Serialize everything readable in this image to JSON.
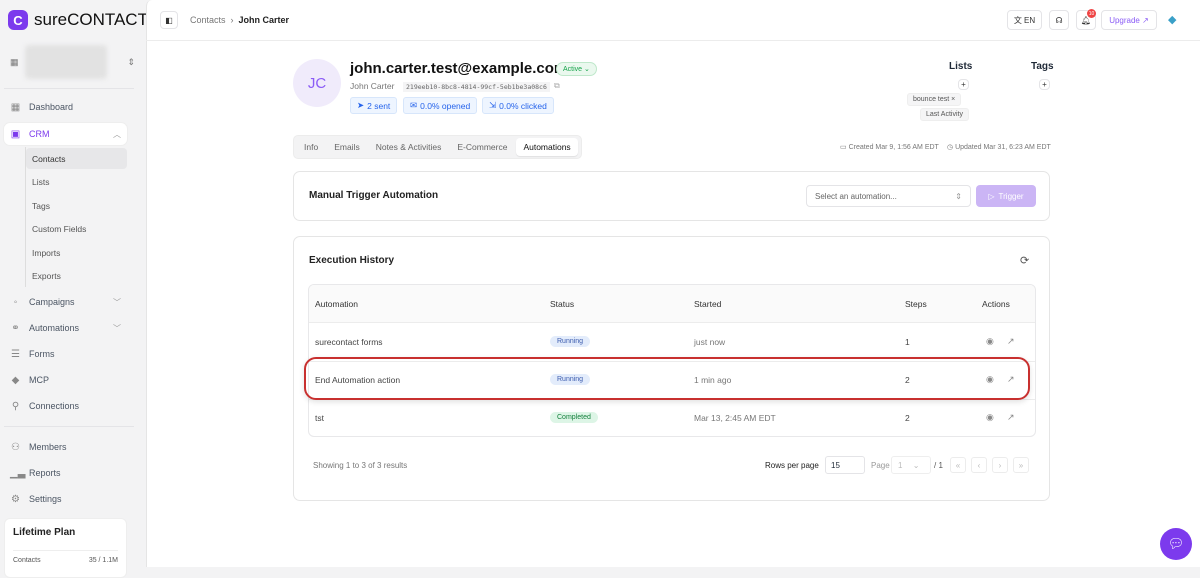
{
  "brand": {
    "logo_letter": "C",
    "name": "sureCONTACT"
  },
  "sidebar": {
    "items": [
      {
        "label": "Dashboard",
        "icon": "grid"
      },
      {
        "label": "CRM",
        "icon": "contact-card"
      },
      {
        "label": "Campaigns",
        "icon": "campaign"
      },
      {
        "label": "Automations",
        "icon": "flow"
      },
      {
        "label": "Forms",
        "icon": "form"
      },
      {
        "label": "MCP",
        "icon": "mcp"
      },
      {
        "label": "Connections",
        "icon": "plug"
      },
      {
        "label": "Members",
        "icon": "users"
      },
      {
        "label": "Reports",
        "icon": "chart"
      },
      {
        "label": "Settings",
        "icon": "gear"
      }
    ],
    "crm_sub": [
      "Contacts",
      "Lists",
      "Tags",
      "Custom Fields",
      "Imports",
      "Exports"
    ],
    "plan": {
      "title": "Lifetime Plan",
      "label": "Contacts",
      "value": "35 / 1.1M"
    }
  },
  "topbar": {
    "breadcrumb_parent": "Contacts",
    "breadcrumb_current": "John Carter",
    "lang": "EN",
    "notif_count": "10",
    "upgrade": "Upgrade ↗"
  },
  "contact": {
    "initials": "JC",
    "email": "john.carter.test@example.com",
    "status": "Active",
    "name": "John Carter",
    "id": "219eeb10-8bc8-4814-99cf-5eb1be3a08c6",
    "sent": "2 sent",
    "opened": "0.0% opened",
    "clicked": "0.0% clicked"
  },
  "lists": {
    "title": "Lists",
    "items": [
      "bounce test",
      "Last Activity"
    ]
  },
  "tags": {
    "title": "Tags"
  },
  "created": "Created Mar 9, 1:56 AM EDT",
  "updated": "Updated Mar 31, 6:23 AM EDT",
  "tabs": [
    "Info",
    "Emails",
    "Notes & Activities",
    "E-Commerce",
    "Automations"
  ],
  "manual": {
    "title": "Manual Trigger Automation",
    "placeholder": "Select an automation...",
    "button": "Trigger"
  },
  "history": {
    "title": "Execution History",
    "columns": [
      "Automation",
      "Status",
      "Started",
      "Steps",
      "Actions"
    ],
    "rows": [
      {
        "automation": "surecontact forms",
        "status": "Running",
        "started": "just now",
        "steps": "1"
      },
      {
        "automation": "End Automation action",
        "status": "Running",
        "started": "1 min ago",
        "steps": "2"
      },
      {
        "automation": "tst",
        "status": "Completed",
        "started": "Mar 13, 2:45 AM EDT",
        "steps": "2"
      }
    ],
    "summary": "Showing 1 to 3 of 3 results",
    "rows_per_page_label": "Rows per page",
    "rows_per_page": "15",
    "page_label": "Page",
    "page": "1",
    "page_total": "/ 1"
  }
}
